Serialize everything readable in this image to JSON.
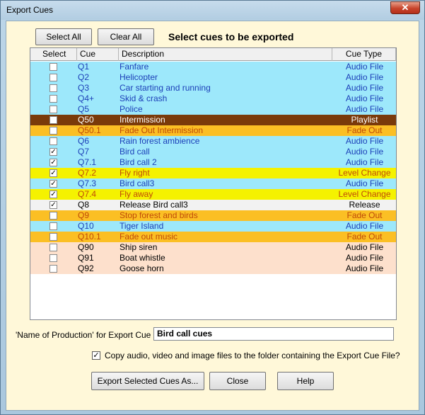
{
  "window": {
    "title": "Export Cues",
    "close_glyph": "✕"
  },
  "toolbar": {
    "select_all": "Select All",
    "clear_all": "Clear All",
    "heading": "Select cues to be exported"
  },
  "grid": {
    "columns": [
      "Select",
      "Cue",
      "Description",
      "Cue Type"
    ],
    "rows": [
      {
        "checked": false,
        "cue": "Q1",
        "desc": "Fanfare",
        "type": "Audio File",
        "bg": "#9de8fb",
        "fg": "#1c3fb8"
      },
      {
        "checked": false,
        "cue": "Q2",
        "desc": "Helicopter",
        "type": "Audio File",
        "bg": "#9de8fb",
        "fg": "#1c3fb8"
      },
      {
        "checked": false,
        "cue": "Q3",
        "desc": "Car starting and running",
        "type": "Audio File",
        "bg": "#9de8fb",
        "fg": "#1c3fb8"
      },
      {
        "checked": false,
        "cue": "Q4+",
        "desc": "Skid & crash",
        "type": "Audio File",
        "bg": "#9de8fb",
        "fg": "#1c3fb8"
      },
      {
        "checked": false,
        "cue": "Q5",
        "desc": "Police",
        "type": "Audio File",
        "bg": "#9de8fb",
        "fg": "#1c3fb8"
      },
      {
        "checked": false,
        "cue": "Q50",
        "desc": "Intermission",
        "type": "Playlist",
        "bg": "#7a3a0a",
        "fg": "#ffffff"
      },
      {
        "checked": false,
        "cue": "Q50.1",
        "desc": "Fade Out Intermission",
        "type": "Fade Out",
        "bg": "#fbbf24",
        "fg": "#c04a08"
      },
      {
        "checked": false,
        "cue": "Q6",
        "desc": "Rain forest ambience",
        "type": "Audio File",
        "bg": "#9de8fb",
        "fg": "#1c3fb8"
      },
      {
        "checked": true,
        "cue": "Q7",
        "desc": "Bird call",
        "type": "Audio File",
        "bg": "#9de8fb",
        "fg": "#1c3fb8"
      },
      {
        "checked": true,
        "cue": "Q7.1",
        "desc": "Bird call 2",
        "type": "Audio File",
        "bg": "#9de8fb",
        "fg": "#1c3fb8"
      },
      {
        "checked": true,
        "cue": "Q7.2",
        "desc": "Fly right",
        "type": "Level Change",
        "bg": "#f5f200",
        "fg": "#c04a08"
      },
      {
        "checked": true,
        "cue": "Q7.3",
        "desc": "Bird call3",
        "type": "Audio File",
        "bg": "#9de8fb",
        "fg": "#1c3fb8"
      },
      {
        "checked": true,
        "cue": "Q7.4",
        "desc": "Fly away",
        "type": "Level Change",
        "bg": "#f5f200",
        "fg": "#c04a08"
      },
      {
        "checked": true,
        "cue": "Q8",
        "desc": "Release Bird call3",
        "type": "Release",
        "bg": "#f2f2f2",
        "fg": "#000000"
      },
      {
        "checked": false,
        "cue": "Q9",
        "desc": "Stop forest and birds",
        "type": "Fade Out",
        "bg": "#fbbf24",
        "fg": "#c04a08"
      },
      {
        "checked": false,
        "cue": "Q10",
        "desc": "Tiger Island",
        "type": "Audio File",
        "bg": "#9de8fb",
        "fg": "#1c3fb8"
      },
      {
        "checked": false,
        "cue": "Q10.1",
        "desc": "Fade out music",
        "type": "Fade Out",
        "bg": "#fbbf24",
        "fg": "#c04a08"
      },
      {
        "checked": false,
        "cue": "Q90",
        "desc": "Ship siren",
        "type": "Audio File",
        "bg": "#fde0cc",
        "fg": "#000000"
      },
      {
        "checked": false,
        "cue": "Q91",
        "desc": "Boat whistle",
        "type": "Audio File",
        "bg": "#fde0cc",
        "fg": "#000000"
      },
      {
        "checked": false,
        "cue": "Q92",
        "desc": "Goose horn",
        "type": "Audio File",
        "bg": "#fde0cc",
        "fg": "#000000"
      }
    ]
  },
  "production": {
    "label": "'Name of Production' for Export Cue File",
    "value": "Bird call cues"
  },
  "copy_option": {
    "checked": true,
    "label": "Copy audio, video and image files to the folder containing the Export Cue File?"
  },
  "footer": {
    "export": "Export Selected Cues As...",
    "close": "Close",
    "help": "Help"
  }
}
